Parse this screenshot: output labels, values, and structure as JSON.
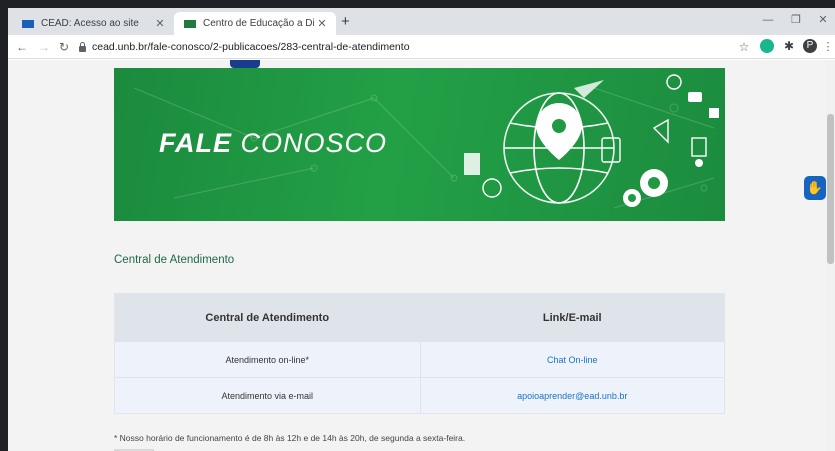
{
  "browser": {
    "tabs": [
      {
        "title": "CEAD: Acesso ao site",
        "close": "✕"
      },
      {
        "title": "Centro de Educação a Distância",
        "close": "✕"
      }
    ],
    "new_tab": "+",
    "window_controls": {
      "minimize": "—",
      "maximize": "❐",
      "close": "✕"
    },
    "nav": {
      "back": "←",
      "forward": "→",
      "reload": "↻"
    },
    "url": "cead.unb.br/fale-conosco/2-publicacoes/283-central-de-atendimento",
    "star": "☆",
    "profile_initial": "P"
  },
  "banner": {
    "title_bold": "FALE",
    "title_light": " CONOSCO"
  },
  "page": {
    "section_title": "Central de Atendimento",
    "table": {
      "headers": [
        "Central de Atendimento",
        "Link/E-mail"
      ],
      "rows": [
        [
          "Atendimento on-line*",
          "Chat On-line"
        ],
        [
          "Atendimento via e-mail",
          "apoioaprender@ead.unb.br"
        ]
      ]
    },
    "footnote": "* Nosso horário de funcionamento é de 8h às 12h e de 14h às 20h, de segunda a sexta-feira."
  },
  "colors": {
    "banner_green": "#1f9a43",
    "link_blue": "#1a73c9",
    "section_green": "#1e6a47",
    "a11y_blue": "#1565c0"
  },
  "icons": {
    "accessibility": "accessibility-hand-icon"
  }
}
